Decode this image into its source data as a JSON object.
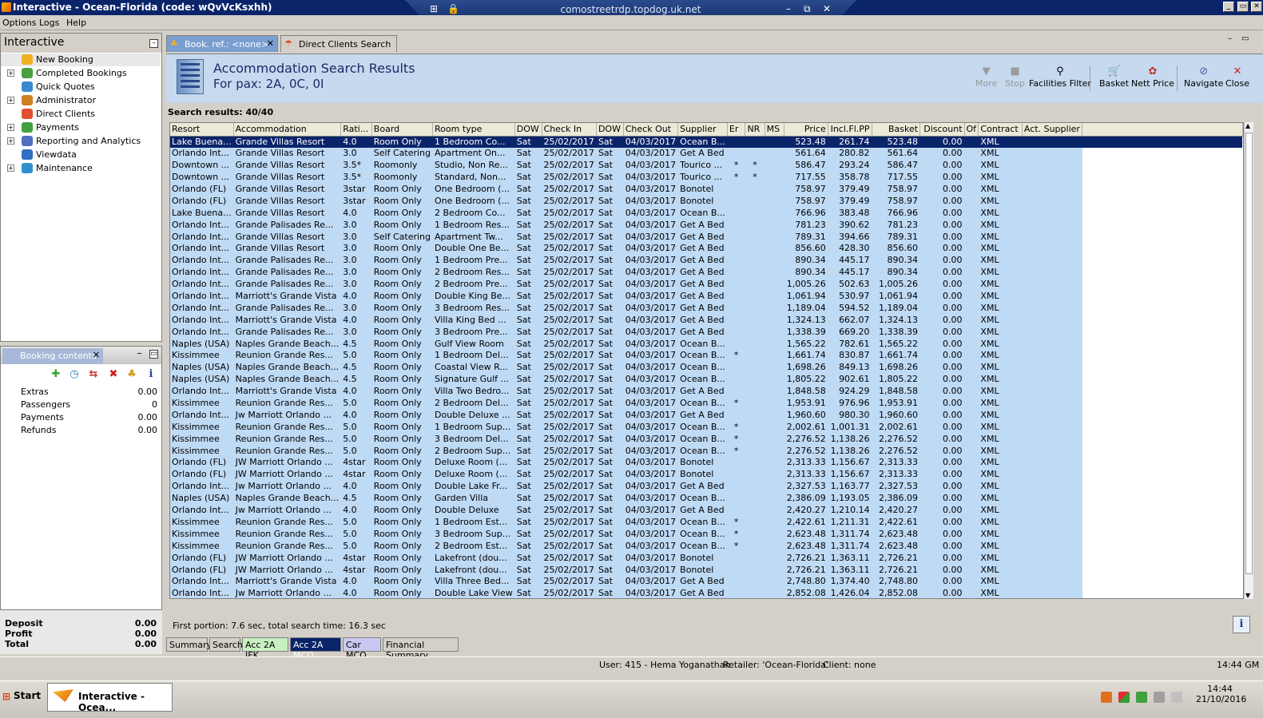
{
  "window": {
    "title": "Interactive - Ocean-Florida (code: wQvVcKsxhh)",
    "rdp_host": "comostreetrdp.topdog.uk.net"
  },
  "menu": [
    "Options",
    "Logs",
    "Help"
  ],
  "nav": {
    "title": "Interactive",
    "items": [
      {
        "label": "New Booking",
        "icon": "palm-tree-icon",
        "expandable": false,
        "color": "#f0b020"
      },
      {
        "label": "Completed Bookings",
        "icon": "palm-tree-icon",
        "expandable": true,
        "color": "#4aa040"
      },
      {
        "label": "Quick Quotes",
        "icon": "clock-icon",
        "expandable": false,
        "color": "#3a8ad0"
      },
      {
        "label": "Administrator",
        "icon": "person-icon",
        "expandable": true,
        "color": "#d08020"
      },
      {
        "label": "Direct Clients",
        "icon": "umbrella-icon",
        "expandable": false,
        "color": "#e05030"
      },
      {
        "label": "Payments",
        "icon": "money-icon",
        "expandable": true,
        "color": "#40a040"
      },
      {
        "label": "Reporting and Analytics",
        "icon": "report-icon",
        "expandable": true,
        "color": "#5070c0"
      },
      {
        "label": "Viewdata",
        "icon": "globe-icon",
        "expandable": false,
        "color": "#3070c0"
      },
      {
        "label": "Maintenance",
        "icon": "toolbox-icon",
        "expandable": true,
        "color": "#3090d0"
      }
    ]
  },
  "booking": {
    "tab": "Booking contents",
    "rows": [
      {
        "label": "Extras",
        "value": "0.00"
      },
      {
        "label": "Passengers",
        "value": "0"
      },
      {
        "label": "Payments",
        "value": "0.00"
      },
      {
        "label": "Refunds",
        "value": "0.00"
      }
    ],
    "totals": [
      {
        "label": "Deposit",
        "value": "0.00"
      },
      {
        "label": "Profit",
        "value": "0.00"
      },
      {
        "label": "Total",
        "value": "0.00"
      }
    ]
  },
  "tabs": [
    {
      "label": "Book. ref.: <none>",
      "active": true
    },
    {
      "label": "Direct Clients Search",
      "active": false
    }
  ],
  "header": {
    "title": "Accommodation Search Results",
    "subtitle": "For pax: 2A, 0C, 0I"
  },
  "toolbar": [
    {
      "label": "More",
      "icon": "down-arrow-icon",
      "glyph": "▼",
      "enabled": false
    },
    {
      "label": "Stop",
      "icon": "stop-icon",
      "glyph": "■",
      "enabled": false
    },
    {
      "label": "Facilities Filter",
      "icon": "filter-icon",
      "glyph": "⚲",
      "enabled": true
    },
    {
      "label": "Basket",
      "icon": "basket-icon",
      "glyph": "🛒",
      "enabled": true
    },
    {
      "label": "Nett Price",
      "icon": "price-icon",
      "glyph": "✿",
      "enabled": true
    },
    {
      "label": "Navigate",
      "icon": "navigate-icon",
      "glyph": "⊘",
      "enabled": true
    },
    {
      "label": "Close",
      "icon": "close-icon",
      "glyph": "✕",
      "enabled": true
    }
  ],
  "results": {
    "summary": "Search results: 40/40",
    "columns": [
      "Resort",
      "Accommodation",
      "Rati...",
      "Board",
      "Room type",
      "DOW",
      "Check In",
      "DOW",
      "Check Out",
      "Supplier",
      "Er",
      "NR",
      "MS",
      "Price",
      "Incl.Fl.PP",
      "Basket",
      "Discount",
      "Of",
      "Contract",
      "Act. Supplier"
    ],
    "rows": [
      [
        "Lake Buena...",
        "Grande Villas Resort",
        "4.0",
        "Room Only",
        "1 Bedroom Co...",
        "Sat",
        "25/02/2017",
        "Sat",
        "04/03/2017",
        "Ocean B...",
        "",
        "",
        "",
        "523.48",
        "261.74",
        "523.48",
        "0.00",
        "",
        "XML",
        ""
      ],
      [
        "Orlando Int...",
        "Grande Villas Resort",
        "3.0",
        "Self Catering",
        "Apartment On...",
        "Sat",
        "25/02/2017",
        "Sat",
        "04/03/2017",
        "Get A Bed",
        "",
        "",
        "",
        "561.64",
        "280.82",
        "561.64",
        "0.00",
        "",
        "XML",
        ""
      ],
      [
        "Downtown ...",
        "Grande Villas Resort",
        "3.5*",
        "Roomonly",
        "Studio, Non Re...",
        "Sat",
        "25/02/2017",
        "Sat",
        "04/03/2017",
        "Tourico ...",
        "*",
        "*",
        "",
        "586.47",
        "293.24",
        "586.47",
        "0.00",
        "",
        "XML",
        ""
      ],
      [
        "Downtown ...",
        "Grande Villas Resort",
        "3.5*",
        "Roomonly",
        "Standard, Non...",
        "Sat",
        "25/02/2017",
        "Sat",
        "04/03/2017",
        "Tourico ...",
        "*",
        "*",
        "",
        "717.55",
        "358.78",
        "717.55",
        "0.00",
        "",
        "XML",
        ""
      ],
      [
        "Orlando (FL)",
        "Grande Villas Resort",
        "3star",
        "Room Only",
        "One Bedroom (...",
        "Sat",
        "25/02/2017",
        "Sat",
        "04/03/2017",
        "Bonotel",
        "",
        "",
        "",
        "758.97",
        "379.49",
        "758.97",
        "0.00",
        "",
        "XML",
        ""
      ],
      [
        "Orlando (FL)",
        "Grande Villas Resort",
        "3star",
        "Room Only",
        "One Bedroom (...",
        "Sat",
        "25/02/2017",
        "Sat",
        "04/03/2017",
        "Bonotel",
        "",
        "",
        "",
        "758.97",
        "379.49",
        "758.97",
        "0.00",
        "",
        "XML",
        ""
      ],
      [
        "Lake Buena...",
        "Grande Villas Resort",
        "4.0",
        "Room Only",
        "2 Bedroom Co...",
        "Sat",
        "25/02/2017",
        "Sat",
        "04/03/2017",
        "Ocean B...",
        "",
        "",
        "",
        "766.96",
        "383.48",
        "766.96",
        "0.00",
        "",
        "XML",
        ""
      ],
      [
        "Orlando Int...",
        "Grande Palisades Re...",
        "3.0",
        "Room Only",
        "1 Bedroom Res...",
        "Sat",
        "25/02/2017",
        "Sat",
        "04/03/2017",
        "Get A Bed",
        "",
        "",
        "",
        "781.23",
        "390.62",
        "781.23",
        "0.00",
        "",
        "XML",
        ""
      ],
      [
        "Orlando Int...",
        "Grande Villas Resort",
        "3.0",
        "Self Catering",
        "Apartment Tw...",
        "Sat",
        "25/02/2017",
        "Sat",
        "04/03/2017",
        "Get A Bed",
        "",
        "",
        "",
        "789.31",
        "394.66",
        "789.31",
        "0.00",
        "",
        "XML",
        ""
      ],
      [
        "Orlando Int...",
        "Grande Villas Resort",
        "3.0",
        "Room Only",
        "Double One Be...",
        "Sat",
        "25/02/2017",
        "Sat",
        "04/03/2017",
        "Get A Bed",
        "",
        "",
        "",
        "856.60",
        "428.30",
        "856.60",
        "0.00",
        "",
        "XML",
        ""
      ],
      [
        "Orlando Int...",
        "Grande Palisades Re...",
        "3.0",
        "Room Only",
        "1 Bedroom Pre...",
        "Sat",
        "25/02/2017",
        "Sat",
        "04/03/2017",
        "Get A Bed",
        "",
        "",
        "",
        "890.34",
        "445.17",
        "890.34",
        "0.00",
        "",
        "XML",
        ""
      ],
      [
        "Orlando Int...",
        "Grande Palisades Re...",
        "3.0",
        "Room Only",
        "2 Bedroom Res...",
        "Sat",
        "25/02/2017",
        "Sat",
        "04/03/2017",
        "Get A Bed",
        "",
        "",
        "",
        "890.34",
        "445.17",
        "890.34",
        "0.00",
        "",
        "XML",
        ""
      ],
      [
        "Orlando Int...",
        "Grande Palisades Re...",
        "3.0",
        "Room Only",
        "2 Bedroom Pre...",
        "Sat",
        "25/02/2017",
        "Sat",
        "04/03/2017",
        "Get A Bed",
        "",
        "",
        "",
        "1,005.26",
        "502.63",
        "1,005.26",
        "0.00",
        "",
        "XML",
        ""
      ],
      [
        "Orlando Int...",
        "Marriott's Grande Vista",
        "4.0",
        "Room Only",
        "Double King Be...",
        "Sat",
        "25/02/2017",
        "Sat",
        "04/03/2017",
        "Get A Bed",
        "",
        "",
        "",
        "1,061.94",
        "530.97",
        "1,061.94",
        "0.00",
        "",
        "XML",
        ""
      ],
      [
        "Orlando Int...",
        "Grande Palisades Re...",
        "3.0",
        "Room Only",
        "3 Bedroom Res...",
        "Sat",
        "25/02/2017",
        "Sat",
        "04/03/2017",
        "Get A Bed",
        "",
        "",
        "",
        "1,189.04",
        "594.52",
        "1,189.04",
        "0.00",
        "",
        "XML",
        ""
      ],
      [
        "Orlando Int...",
        "Marriott's Grande Vista",
        "4.0",
        "Room Only",
        "Villa King Bed ...",
        "Sat",
        "25/02/2017",
        "Sat",
        "04/03/2017",
        "Get A Bed",
        "",
        "",
        "",
        "1,324.13",
        "662.07",
        "1,324.13",
        "0.00",
        "",
        "XML",
        ""
      ],
      [
        "Orlando Int...",
        "Grande Palisades Re...",
        "3.0",
        "Room Only",
        "3 Bedroom Pre...",
        "Sat",
        "25/02/2017",
        "Sat",
        "04/03/2017",
        "Get A Bed",
        "",
        "",
        "",
        "1,338.39",
        "669.20",
        "1,338.39",
        "0.00",
        "",
        "XML",
        ""
      ],
      [
        "Naples (USA)",
        "Naples Grande Beach...",
        "4.5",
        "Room Only",
        "Gulf View Room",
        "Sat",
        "25/02/2017",
        "Sat",
        "04/03/2017",
        "Ocean B...",
        "",
        "",
        "",
        "1,565.22",
        "782.61",
        "1,565.22",
        "0.00",
        "",
        "XML",
        ""
      ],
      [
        "Kissimmee",
        "Reunion Grande Res...",
        "5.0",
        "Room Only",
        "1 Bedroom Del...",
        "Sat",
        "25/02/2017",
        "Sat",
        "04/03/2017",
        "Ocean B...",
        "*",
        "",
        "",
        "1,661.74",
        "830.87",
        "1,661.74",
        "0.00",
        "",
        "XML",
        ""
      ],
      [
        "Naples (USA)",
        "Naples Grande Beach...",
        "4.5",
        "Room Only",
        "Coastal View R...",
        "Sat",
        "25/02/2017",
        "Sat",
        "04/03/2017",
        "Ocean B...",
        "",
        "",
        "",
        "1,698.26",
        "849.13",
        "1,698.26",
        "0.00",
        "",
        "XML",
        ""
      ],
      [
        "Naples (USA)",
        "Naples Grande Beach...",
        "4.5",
        "Room Only",
        "Signature Gulf ...",
        "Sat",
        "25/02/2017",
        "Sat",
        "04/03/2017",
        "Ocean B...",
        "",
        "",
        "",
        "1,805.22",
        "902.61",
        "1,805.22",
        "0.00",
        "",
        "XML",
        ""
      ],
      [
        "Orlando Int...",
        "Marriott's Grande Vista",
        "4.0",
        "Room Only",
        "Villa Two Bedro...",
        "Sat",
        "25/02/2017",
        "Sat",
        "04/03/2017",
        "Get A Bed",
        "",
        "",
        "",
        "1,848.58",
        "924.29",
        "1,848.58",
        "0.00",
        "",
        "XML",
        ""
      ],
      [
        "Kissimmee",
        "Reunion Grande Res...",
        "5.0",
        "Room Only",
        "2 Bedroom Del...",
        "Sat",
        "25/02/2017",
        "Sat",
        "04/03/2017",
        "Ocean B...",
        "*",
        "",
        "",
        "1,953.91",
        "976.96",
        "1,953.91",
        "0.00",
        "",
        "XML",
        ""
      ],
      [
        "Orlando Int...",
        "Jw Marriott Orlando ...",
        "4.0",
        "Room Only",
        "Double Deluxe ...",
        "Sat",
        "25/02/2017",
        "Sat",
        "04/03/2017",
        "Get A Bed",
        "",
        "",
        "",
        "1,960.60",
        "980.30",
        "1,960.60",
        "0.00",
        "",
        "XML",
        ""
      ],
      [
        "Kissimmee",
        "Reunion Grande Res...",
        "5.0",
        "Room Only",
        "1 Bedroom Sup...",
        "Sat",
        "25/02/2017",
        "Sat",
        "04/03/2017",
        "Ocean B...",
        "*",
        "",
        "",
        "2,002.61",
        "1,001.31",
        "2,002.61",
        "0.00",
        "",
        "XML",
        ""
      ],
      [
        "Kissimmee",
        "Reunion Grande Res...",
        "5.0",
        "Room Only",
        "3 Bedroom Del...",
        "Sat",
        "25/02/2017",
        "Sat",
        "04/03/2017",
        "Ocean B...",
        "*",
        "",
        "",
        "2,276.52",
        "1,138.26",
        "2,276.52",
        "0.00",
        "",
        "XML",
        ""
      ],
      [
        "Kissimmee",
        "Reunion Grande Res...",
        "5.0",
        "Room Only",
        "2 Bedroom Sup...",
        "Sat",
        "25/02/2017",
        "Sat",
        "04/03/2017",
        "Ocean B...",
        "*",
        "",
        "",
        "2,276.52",
        "1,138.26",
        "2,276.52",
        "0.00",
        "",
        "XML",
        ""
      ],
      [
        "Orlando (FL)",
        "JW Marriott Orlando ...",
        "4star",
        "Room Only",
        "Deluxe Room (...",
        "Sat",
        "25/02/2017",
        "Sat",
        "04/03/2017",
        "Bonotel",
        "",
        "",
        "",
        "2,313.33",
        "1,156.67",
        "2,313.33",
        "0.00",
        "",
        "XML",
        ""
      ],
      [
        "Orlando (FL)",
        "JW Marriott Orlando ...",
        "4star",
        "Room Only",
        "Deluxe Room (...",
        "Sat",
        "25/02/2017",
        "Sat",
        "04/03/2017",
        "Bonotel",
        "",
        "",
        "",
        "2,313.33",
        "1,156.67",
        "2,313.33",
        "0.00",
        "",
        "XML",
        ""
      ],
      [
        "Orlando Int...",
        "Jw Marriott Orlando ...",
        "4.0",
        "Room Only",
        "Double Lake Fr...",
        "Sat",
        "25/02/2017",
        "Sat",
        "04/03/2017",
        "Get A Bed",
        "",
        "",
        "",
        "2,327.53",
        "1,163.77",
        "2,327.53",
        "0.00",
        "",
        "XML",
        ""
      ],
      [
        "Naples (USA)",
        "Naples Grande Beach...",
        "4.5",
        "Room Only",
        "Garden Villa",
        "Sat",
        "25/02/2017",
        "Sat",
        "04/03/2017",
        "Ocean B...",
        "",
        "",
        "",
        "2,386.09",
        "1,193.05",
        "2,386.09",
        "0.00",
        "",
        "XML",
        ""
      ],
      [
        "Orlando Int...",
        "Jw Marriott Orlando ...",
        "4.0",
        "Room Only",
        "Double Deluxe",
        "Sat",
        "25/02/2017",
        "Sat",
        "04/03/2017",
        "Get A Bed",
        "",
        "",
        "",
        "2,420.27",
        "1,210.14",
        "2,420.27",
        "0.00",
        "",
        "XML",
        ""
      ],
      [
        "Kissimmee",
        "Reunion Grande Res...",
        "5.0",
        "Room Only",
        "1 Bedroom Est...",
        "Sat",
        "25/02/2017",
        "Sat",
        "04/03/2017",
        "Ocean B...",
        "*",
        "",
        "",
        "2,422.61",
        "1,211.31",
        "2,422.61",
        "0.00",
        "",
        "XML",
        ""
      ],
      [
        "Kissimmee",
        "Reunion Grande Res...",
        "5.0",
        "Room Only",
        "3 Bedroom Sup...",
        "Sat",
        "25/02/2017",
        "Sat",
        "04/03/2017",
        "Ocean B...",
        "*",
        "",
        "",
        "2,623.48",
        "1,311.74",
        "2,623.48",
        "0.00",
        "",
        "XML",
        ""
      ],
      [
        "Kissimmee",
        "Reunion Grande Res...",
        "5.0",
        "Room Only",
        "2 Bedroom Est...",
        "Sat",
        "25/02/2017",
        "Sat",
        "04/03/2017",
        "Ocean B...",
        "*",
        "",
        "",
        "2,623.48",
        "1,311.74",
        "2,623.48",
        "0.00",
        "",
        "XML",
        ""
      ],
      [
        "Orlando (FL)",
        "JW Marriott Orlando ...",
        "4star",
        "Room Only",
        "Lakefront (dou...",
        "Sat",
        "25/02/2017",
        "Sat",
        "04/03/2017",
        "Bonotel",
        "",
        "",
        "",
        "2,726.21",
        "1,363.11",
        "2,726.21",
        "0.00",
        "",
        "XML",
        ""
      ],
      [
        "Orlando (FL)",
        "JW Marriott Orlando ...",
        "4star",
        "Room Only",
        "Lakefront (dou...",
        "Sat",
        "25/02/2017",
        "Sat",
        "04/03/2017",
        "Bonotel",
        "",
        "",
        "",
        "2,726.21",
        "1,363.11",
        "2,726.21",
        "0.00",
        "",
        "XML",
        ""
      ],
      [
        "Orlando Int...",
        "Marriott's Grande Vista",
        "4.0",
        "Room Only",
        "Villa Three Bed...",
        "Sat",
        "25/02/2017",
        "Sat",
        "04/03/2017",
        "Get A Bed",
        "",
        "",
        "",
        "2,748.80",
        "1,374.40",
        "2,748.80",
        "0.00",
        "",
        "XML",
        ""
      ],
      [
        "Orlando Int...",
        "Jw Marriott Orlando ...",
        "4.0",
        "Room Only",
        "Double Lake View",
        "Sat",
        "25/02/2017",
        "Sat",
        "04/03/2017",
        "Get A Bed",
        "",
        "",
        "",
        "2,852.08",
        "1,426.04",
        "2,852.08",
        "0.00",
        "",
        "XML",
        ""
      ]
    ]
  },
  "status_message": "First portion: 7.6 sec, total search time: 16.3 sec",
  "bottom_tabs": [
    {
      "label": "Summary",
      "bg": "#d4d0c8",
      "fg": "#000000"
    },
    {
      "label": "Search",
      "bg": "#d4d0c8",
      "fg": "#000000"
    },
    {
      "label": "Acc 2A JFK",
      "bg": "#c8f0c0",
      "fg": "#000000"
    },
    {
      "label": "Acc 2A MCO",
      "bg": "#0a246a",
      "fg": "#ffffff"
    },
    {
      "label": "Car MCO",
      "bg": "#c8c8f0",
      "fg": "#000000"
    },
    {
      "label": "Financial Summary",
      "bg": "#d4d0c8",
      "fg": "#000000"
    }
  ],
  "statusbar": {
    "user": "User: 415 - Hema Yoganathan",
    "retailer": "Retailer: 'Ocean-Florida'",
    "client": "Client: none",
    "time": "14:44 GM"
  },
  "taskbar": {
    "start": "Start",
    "item": "Interactive - Ocea...",
    "clock_time": "14:44",
    "clock_date": "21/10/2016"
  }
}
